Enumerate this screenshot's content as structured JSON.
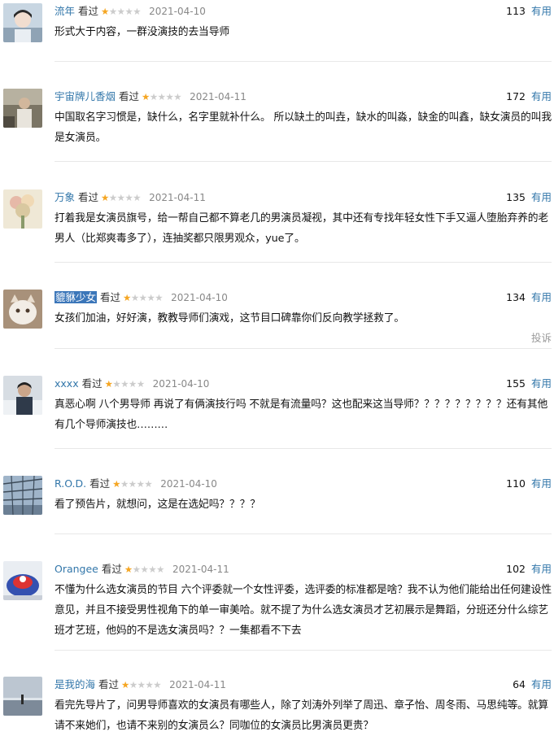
{
  "comments": [
    {
      "user": "流年",
      "watched": "看过",
      "rating": 1,
      "date": "2021-04-10",
      "count": "113",
      "useful": "有用",
      "content": "形式大于内容，一群没演技的去当导师",
      "avatar_color": "#9fb6c9"
    },
    {
      "user": "宇宙牌儿香烟",
      "watched": "看过",
      "rating": 1,
      "date": "2021-04-11",
      "count": "172",
      "useful": "有用",
      "content": "中国取名字习惯是，缺什么，名字里就补什么。 所以缺土的叫垚，缺水的叫淼，缺金的叫鑫，缺女演员的叫我是女演员。",
      "avatar_color": "#6f6a5e"
    },
    {
      "user": "万象",
      "watched": "看过",
      "rating": 1,
      "date": "2021-04-11",
      "count": "135",
      "useful": "有用",
      "content": "打着我是女演员旗号，给一帮自己都不算老几的男演员凝视，其中还有专找年轻女性下手又逼人堕胎弃养的老男人（比郑爽毒多了），连抽奖都只限男观众，yue了。",
      "avatar_color": "#d9cfae"
    },
    {
      "user": "貔貅少女",
      "watched": "看过",
      "rating": 1,
      "date": "2021-04-10",
      "count": "134",
      "useful": "有用",
      "content": "女孩们加油，好好演，教教导师们演戏，这节目口碑靠你们反向教学拯救了。",
      "report": "投诉",
      "avatar_color": "#c9b39a"
    },
    {
      "user": "xxxx",
      "watched": "看过",
      "rating": 1,
      "date": "2021-04-10",
      "count": "155",
      "useful": "有用",
      "content": "真恶心啊 八个男导师 再说了有俩演技行吗 不就是有流量吗？这也配来这当导师？？？？？？？？？还有其他有几个导师演技也………",
      "avatar_color": "#3e4a5a"
    },
    {
      "user": "R.O.D.",
      "watched": "看过",
      "rating": 1,
      "date": "2021-04-10",
      "count": "110",
      "useful": "有用",
      "content": "看了预告片，就想问，这是在选妃吗？？？？",
      "avatar_color": "#8aa4c0"
    },
    {
      "user": "Orangee",
      "watched": "看过",
      "rating": 1,
      "date": "2021-04-11",
      "count": "102",
      "useful": "有用",
      "content": "不懂为什么选女演员的节目 六个评委就一个女性评委，选评委的标准都是啥？我不认为他们能给出任何建设性意见，并且不接受男性视角下的单一审美哈。就不提了为什么选女演员才艺初展示是舞蹈，分班还分什么综艺班才艺班，他妈的不是选女演员吗？？一集都看不下去",
      "avatar_color": "#3a54b4"
    },
    {
      "user": "是我的海",
      "watched": "看过",
      "rating": 1,
      "date": "2021-04-11",
      "count": "64",
      "useful": "有用",
      "content": "看完先导片了，问男导师喜欢的女演员有哪些人，除了刘涛外列举了周迅、章子怡、周冬雨、马思纯等。就算请不来她们，也请不来别的女演员么？同咖位的女演员比男演员更贵？",
      "avatar_color": "#8393a6"
    }
  ]
}
